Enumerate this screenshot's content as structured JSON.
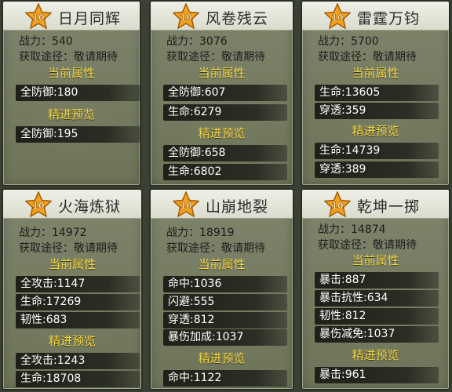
{
  "labels": {
    "power_prefix": "战力：",
    "source_prefix": "获取途径：",
    "current_attr": "当前属性",
    "refine_preview": "精进预览"
  },
  "cards": [
    {
      "level": "10",
      "name": "日月同辉",
      "power": "540",
      "source": "敬请期待",
      "current": [
        "全防御:180"
      ],
      "preview": [
        "全防御:195"
      ]
    },
    {
      "level": "10",
      "name": "风卷残云",
      "power": "3076",
      "source": "敬请期待",
      "current": [
        "全防御:607",
        "生命:6279"
      ],
      "preview": [
        "全防御:658",
        "生命:6802"
      ]
    },
    {
      "level": "10",
      "name": "雷霆万钧",
      "power": "5700",
      "source": "敬请期待",
      "current": [
        "生命:13605",
        "穿透:359"
      ],
      "preview": [
        "生命:14739",
        "穿透:389"
      ]
    },
    {
      "level": "10",
      "name": "火海炼狱",
      "power": "14972",
      "source": "敬请期待",
      "current": [
        "全攻击:1147",
        "生命:17269",
        "韧性:683"
      ],
      "preview": [
        "全攻击:1243",
        "生命:18708"
      ]
    },
    {
      "level": "10",
      "name": "山崩地裂",
      "power": "18919",
      "source": "敬请期待",
      "current": [
        "命中:1036",
        "闪避:555",
        "穿透:812",
        "暴伤加成:1037"
      ],
      "preview": [
        "命中:1122"
      ]
    },
    {
      "level": "10",
      "name": "乾坤一掷",
      "power": "14874",
      "source": "敬请期待",
      "current": [
        "暴击:887",
        "暴击抗性:634",
        "韧性:812",
        "暴伤减免:1037"
      ],
      "preview": [
        "暴击:961"
      ]
    }
  ]
}
